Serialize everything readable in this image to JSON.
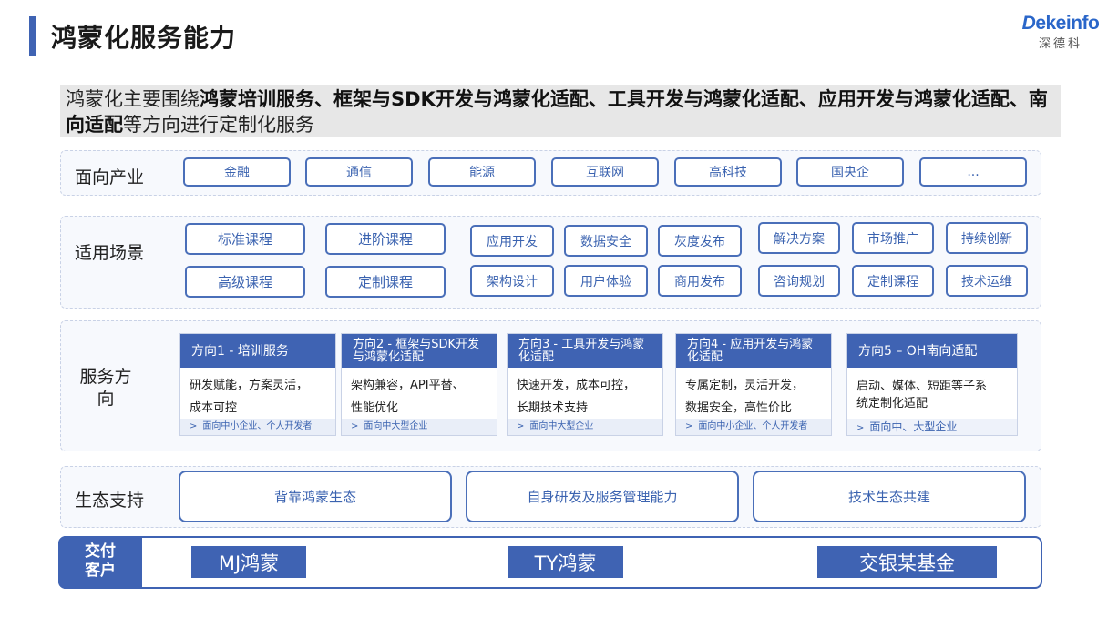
{
  "header": {
    "title": "鸿蒙化服务能力"
  },
  "logo": {
    "brand": "Dekeinfo",
    "brand_first": "D",
    "brand_rest": "ekeinfo",
    "sub": "深德科"
  },
  "intro": {
    "p1": "鸿蒙化主要围绕",
    "p2": "鸿蒙培训服务、框架与SDK开发与鸿蒙化适配、工具开发与鸿蒙化适配、应用开发与鸿蒙化适配、南向适配",
    "p3": "等方向进行定制化服务"
  },
  "industry": {
    "label": "面向产业",
    "items": [
      "金融",
      "通信",
      "能源",
      "互联网",
      "高科技",
      "国央企",
      "..."
    ]
  },
  "scenarios": {
    "label": "适用场景",
    "items": [
      "标准课程",
      "进阶课程",
      "应用开发",
      "数据安全",
      "灰度发布",
      "解决方案",
      "市场推广",
      "持续创新",
      "高级课程",
      "定制课程",
      "架构设计",
      "用户体验",
      "商用发布",
      "咨询规划",
      "定制课程",
      "技术运维"
    ]
  },
  "directions": {
    "label": "服务方向",
    "items": [
      {
        "title": "方向1 - 培训服务",
        "l1": "研发赋能，方案灵活，",
        "l2": "成本可控",
        "foot": "面向中小企业、个人开发者"
      },
      {
        "title": "方向2 - 框架与SDK开发与鸿蒙化适配",
        "l1": "架构兼容，API平替、",
        "l2": "性能优化",
        "foot": "面向中大型企业"
      },
      {
        "title": "方向3 - 工具开发与鸿蒙化适配",
        "l1": "快速开发，成本可控，",
        "l2": "长期技术支持",
        "foot": "面向中大型企业"
      },
      {
        "title": "方向4 - 应用开发与鸿蒙化适配",
        "l1": "专属定制，灵活开发，",
        "l2": "数据安全，高性价比",
        "foot": "面向中小企业、个人开发者"
      },
      {
        "title": "方向5 – OH南向适配",
        "l1": "启动、媒体、短距等子系",
        "l2": "统定制化适配",
        "foot": "面向中、大型企业"
      }
    ]
  },
  "ecosystem": {
    "label": "生态支持",
    "items": [
      "背靠鸿蒙生态",
      "自身研发及服务管理能力",
      "技术生态共建"
    ]
  },
  "clients": {
    "label_l1": "交付",
    "label_l2": "客户",
    "items": [
      "MJ鸿蒙",
      "TY鸿蒙",
      "交银某基金"
    ]
  },
  "colors": {
    "accent": "#3f63b3",
    "pill_border": "#4a6fb9",
    "panel_bg": "#f7f9fd",
    "intro_bg": "#e7e7e7"
  }
}
